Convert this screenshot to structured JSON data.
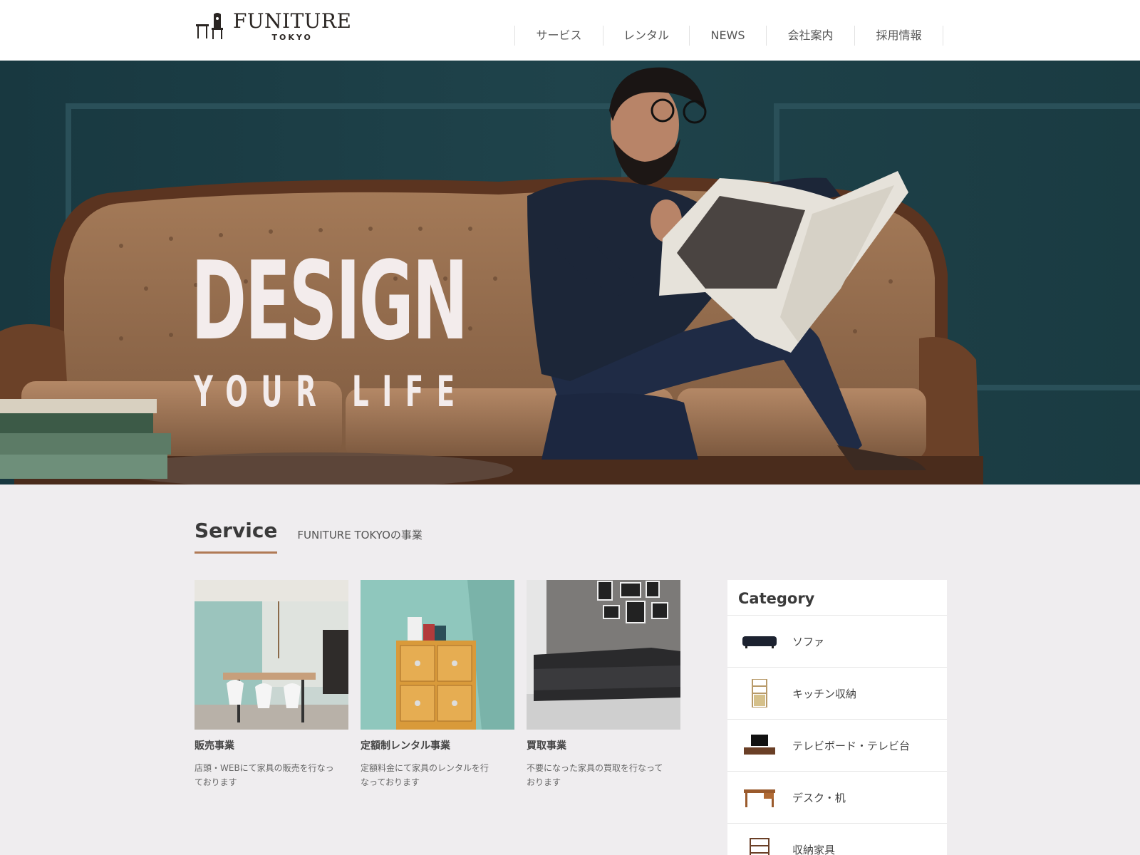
{
  "header": {
    "logo_title": "FUNITURE",
    "logo_sub": "TOKYO",
    "nav": [
      "サービス",
      "レンタル",
      "NEWS",
      "会社案内",
      "採用情報"
    ]
  },
  "hero": {
    "title": "DESIGN",
    "subtitle": "YOUR LIFE"
  },
  "service": {
    "title": "Service",
    "subtitle": "FUNITURE TOKYOの事業",
    "cards": [
      {
        "title": "販売事業",
        "text_line1": "店頭・WEBにて家具の販売を行なっ",
        "text_line2": "ております"
      },
      {
        "title": "定額制レンタル事業",
        "text_line1": "定額料金にて家具のレンタルを行",
        "text_line2": "なっております"
      },
      {
        "title": "買取事業",
        "text_line1": "不要になった家具の買取を行なって",
        "text_line2": "おります"
      }
    ]
  },
  "category": {
    "title": "Category",
    "items": [
      {
        "label": "ソファ",
        "icon": "sofa-icon"
      },
      {
        "label": "キッチン収納",
        "icon": "kitchen-shelf-icon"
      },
      {
        "label": "テレビボード・テレビ台",
        "icon": "tv-board-icon"
      },
      {
        "label": "デスク・机",
        "icon": "desk-icon"
      },
      {
        "label": "収納家具",
        "icon": "storage-icon"
      }
    ]
  },
  "colors": {
    "accent": "#b07a55",
    "hero_wall": "#1d3f46",
    "background": "#efedef"
  }
}
